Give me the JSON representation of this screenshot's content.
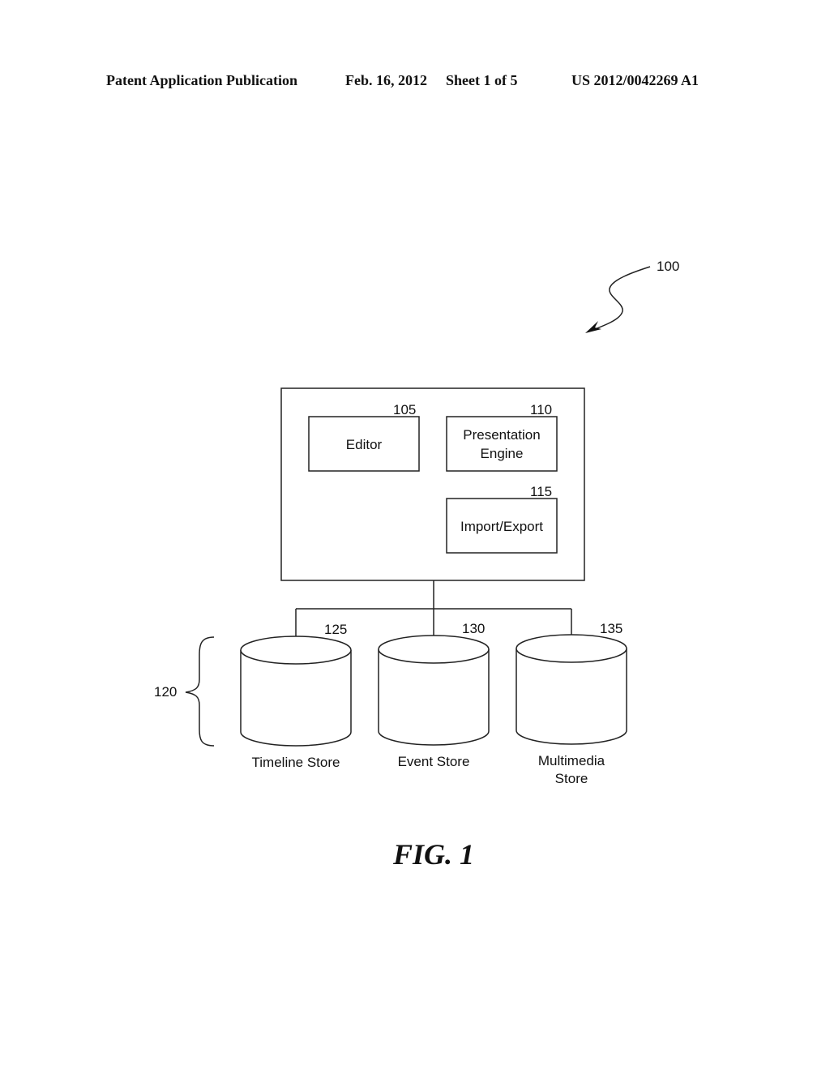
{
  "header": {
    "publication_type": "Patent Application Publication",
    "date": "Feb. 16, 2012",
    "sheet": "Sheet 1 of 5",
    "patent_number": "US 2012/0042269 A1"
  },
  "diagram": {
    "system_ref": "100",
    "components": [
      {
        "ref": "105",
        "label_lines": [
          "Editor"
        ]
      },
      {
        "ref": "110",
        "label_lines": [
          "Presentation",
          "Engine"
        ]
      },
      {
        "ref": "115",
        "label_lines": [
          "Import/Export"
        ]
      }
    ],
    "storage_group_ref": "120",
    "stores": [
      {
        "ref": "125",
        "label_lines": [
          "Timeline Store"
        ]
      },
      {
        "ref": "130",
        "label_lines": [
          "Event Store"
        ]
      },
      {
        "ref": "135",
        "label_lines": [
          "Multimedia",
          "Store"
        ]
      }
    ],
    "figure_label": "FIG. 1"
  }
}
